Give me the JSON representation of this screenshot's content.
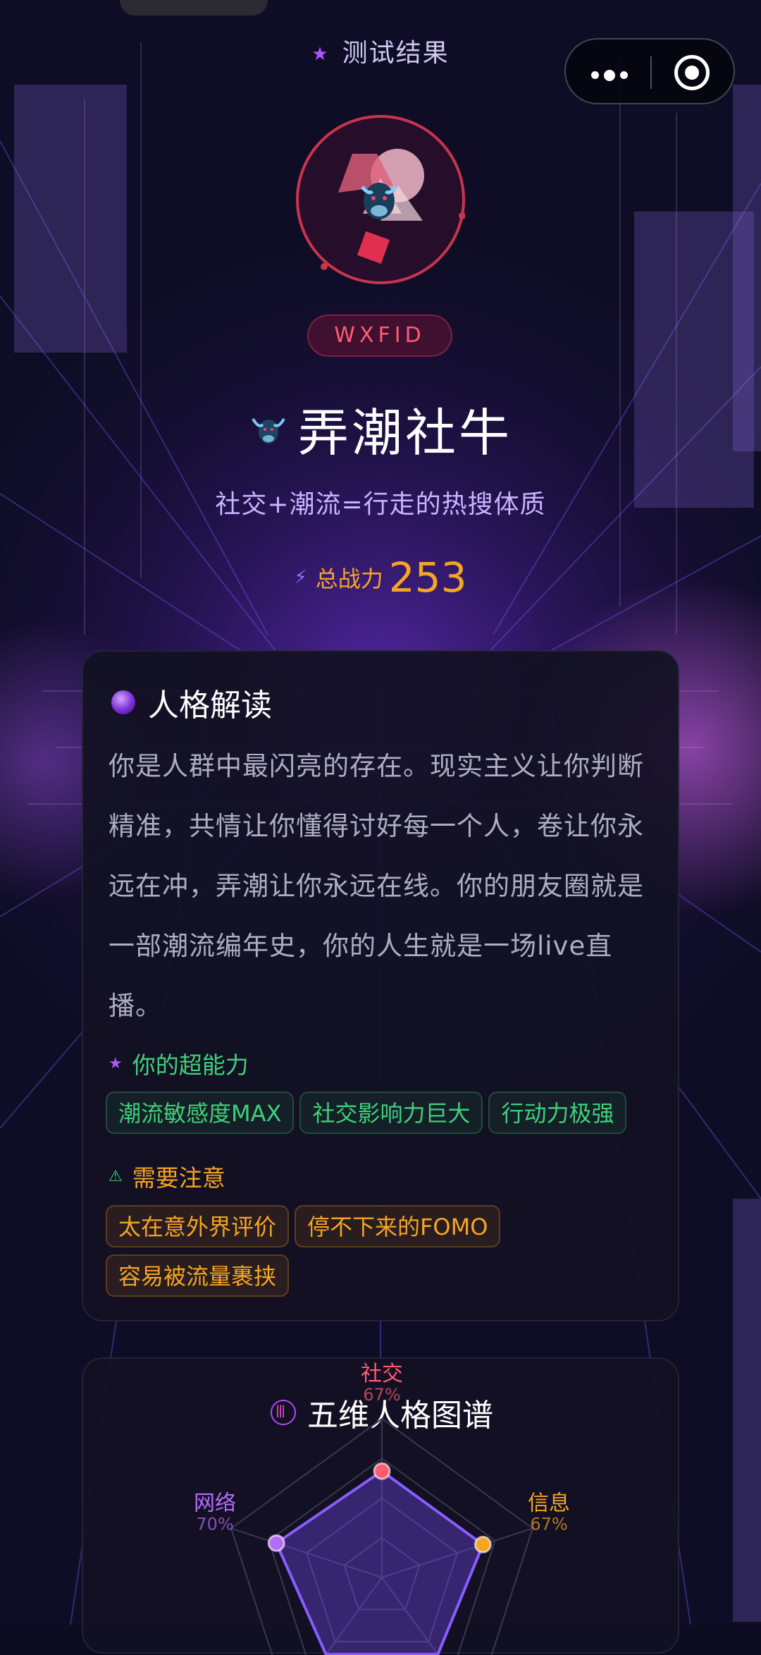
{
  "header": {
    "page_title": "测试结果",
    "capsule_menu_icon": "more-dots-icon",
    "capsule_close_icon": "target-close-icon"
  },
  "profile": {
    "badge": "WXFID",
    "type_name": "弄潮社牛",
    "tagline": "社交+潮流=行走的热搜体质",
    "power_label": "总战力",
    "power_value": "253"
  },
  "interpretation": {
    "title": "人格解读",
    "text": "你是人群中最闪亮的存在。现实主义让你判断精准，共情让你懂得讨好每一个人，卷让你永远在冲，弄潮让你永远在线。你的朋友圈就是一部潮流编年史，你的人生就是一场live直播。",
    "strengths_title": "你的超能力",
    "strengths": [
      "潮流敏感度MAX",
      "社交影响力巨大",
      "行动力极强"
    ],
    "cautions_title": "需要注意",
    "cautions": [
      "太在意外界评价",
      "停不下来的FOMO",
      "容易被流量裹挟"
    ]
  },
  "chart_data": {
    "type": "radar",
    "title": "五维人格图谱",
    "axes": [
      {
        "name": "社交",
        "value": 67,
        "label": "67%",
        "color": "#ff5c73"
      },
      {
        "name": "信息",
        "value": 67,
        "label": "67%",
        "color": "#f5a524"
      },
      {
        "name": "网络",
        "value": 70,
        "label": "70%",
        "color": "#b36cff"
      }
    ],
    "range": [
      0,
      100
    ]
  },
  "colors": {
    "accent_purple": "#a46cff",
    "accent_gold": "#f5a524",
    "accent_green": "#3fd07a",
    "accent_red": "#ff5c73"
  }
}
